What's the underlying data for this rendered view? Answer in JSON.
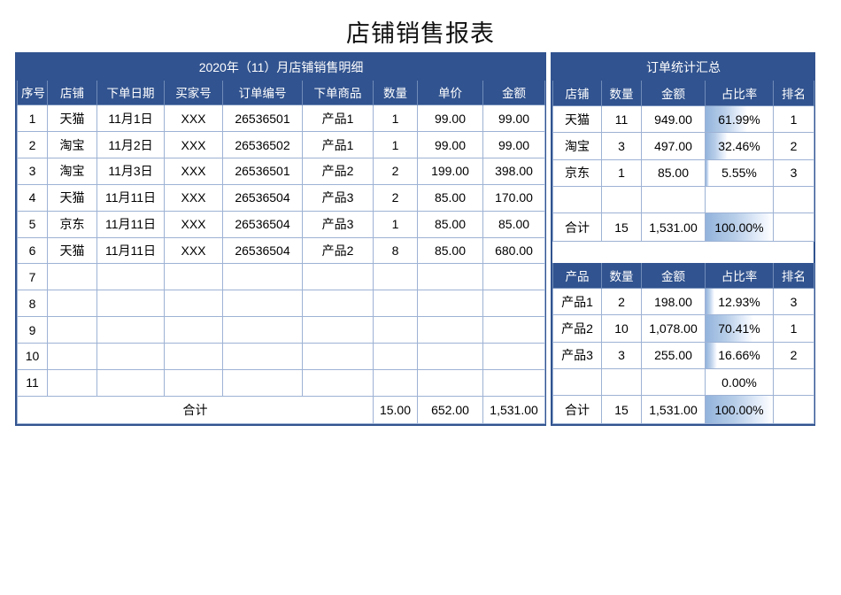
{
  "page": {
    "title": "店铺销售报表"
  },
  "left_table": {
    "band_title": "2020年（11）月店铺销售明细",
    "headers": [
      "序号",
      "店铺",
      "下单日期",
      "买家号",
      "订单编号",
      "下单商品",
      "数量",
      "单价",
      "金额"
    ],
    "rows": [
      {
        "no": "1",
        "shop": "天猫",
        "date": "11月1日",
        "buyer": "XXX",
        "order": "26536501",
        "product": "产品1",
        "qty": "1",
        "price": "99.00",
        "amount": "99.00"
      },
      {
        "no": "2",
        "shop": "淘宝",
        "date": "11月2日",
        "buyer": "XXX",
        "order": "26536502",
        "product": "产品1",
        "qty": "1",
        "price": "99.00",
        "amount": "99.00"
      },
      {
        "no": "3",
        "shop": "淘宝",
        "date": "11月3日",
        "buyer": "XXX",
        "order": "26536501",
        "product": "产品2",
        "qty": "2",
        "price": "199.00",
        "amount": "398.00"
      },
      {
        "no": "4",
        "shop": "天猫",
        "date": "11月11日",
        "buyer": "XXX",
        "order": "26536504",
        "product": "产品3",
        "qty": "2",
        "price": "85.00",
        "amount": "170.00"
      },
      {
        "no": "5",
        "shop": "京东",
        "date": "11月11日",
        "buyer": "XXX",
        "order": "26536504",
        "product": "产品3",
        "qty": "1",
        "price": "85.00",
        "amount": "85.00"
      },
      {
        "no": "6",
        "shop": "天猫",
        "date": "11月11日",
        "buyer": "XXX",
        "order": "26536504",
        "product": "产品2",
        "qty": "8",
        "price": "85.00",
        "amount": "680.00"
      },
      {
        "no": "7",
        "shop": "",
        "date": "",
        "buyer": "",
        "order": "",
        "product": "",
        "qty": "",
        "price": "",
        "amount": ""
      },
      {
        "no": "8",
        "shop": "",
        "date": "",
        "buyer": "",
        "order": "",
        "product": "",
        "qty": "",
        "price": "",
        "amount": ""
      },
      {
        "no": "9",
        "shop": "",
        "date": "",
        "buyer": "",
        "order": "",
        "product": "",
        "qty": "",
        "price": "",
        "amount": ""
      },
      {
        "no": "10",
        "shop": "",
        "date": "",
        "buyer": "",
        "order": "",
        "product": "",
        "qty": "",
        "price": "",
        "amount": ""
      },
      {
        "no": "11",
        "shop": "",
        "date": "",
        "buyer": "",
        "order": "",
        "product": "",
        "qty": "",
        "price": "",
        "amount": ""
      }
    ],
    "total": {
      "label": "合计",
      "qty": "15.00",
      "price": "652.00",
      "amount": "1,531.00"
    }
  },
  "right_panel": {
    "band_title": "订单统计汇总",
    "shop_table": {
      "headers": [
        "店铺",
        "数量",
        "金额",
        "占比率",
        "排名"
      ],
      "rows": [
        {
          "name": "天猫",
          "qty": "11",
          "amount": "949.00",
          "pct": "61.99%",
          "pct_value": 61.99,
          "rank": "1"
        },
        {
          "name": "淘宝",
          "qty": "3",
          "amount": "497.00",
          "pct": "32.46%",
          "pct_value": 32.46,
          "rank": "2"
        },
        {
          "name": "京东",
          "qty": "1",
          "amount": "85.00",
          "pct": "5.55%",
          "pct_value": 5.55,
          "rank": "3"
        },
        {
          "name": "",
          "qty": "",
          "amount": "",
          "pct": "",
          "pct_value": 0,
          "rank": ""
        }
      ],
      "total": {
        "label": "合计",
        "qty": "15",
        "amount": "1,531.00",
        "pct": "100.00%",
        "pct_value": 100,
        "rank": ""
      }
    },
    "product_table": {
      "headers": [
        "产品",
        "数量",
        "金额",
        "占比率",
        "排名"
      ],
      "rows": [
        {
          "name": "产品1",
          "qty": "2",
          "amount": "198.00",
          "pct": "12.93%",
          "pct_value": 12.93,
          "rank": "3"
        },
        {
          "name": "产品2",
          "qty": "10",
          "amount": "1,078.00",
          "pct": "70.41%",
          "pct_value": 70.41,
          "rank": "1"
        },
        {
          "name": "产品3",
          "qty": "3",
          "amount": "255.00",
          "pct": "16.66%",
          "pct_value": 16.66,
          "rank": "2"
        },
        {
          "name": "",
          "qty": "",
          "amount": "",
          "pct": "0.00%",
          "pct_value": 0,
          "rank": ""
        }
      ],
      "total": {
        "label": "合计",
        "qty": "15",
        "amount": "1,531.00",
        "pct": "100.00%",
        "pct_value": 100,
        "rank": ""
      }
    }
  },
  "colors": {
    "header_blue": "#31538F",
    "grid_blue": "#9db2d4",
    "bar_blue": "#93b3dc"
  }
}
